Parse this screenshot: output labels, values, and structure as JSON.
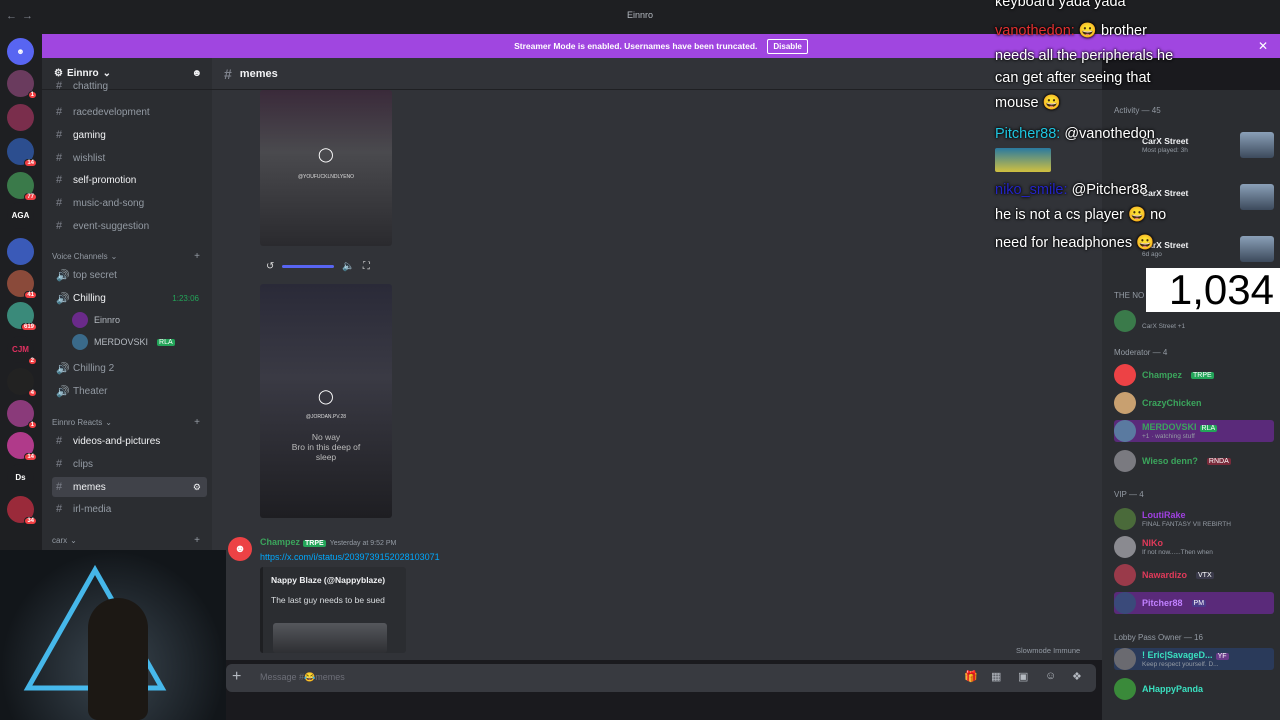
{
  "window": {
    "title": "Einnro"
  },
  "banner": {
    "text": "Streamer Mode is enabled. Usernames have been truncated.",
    "button": "Disable"
  },
  "guilds": [
    {
      "label": "",
      "badge": "1"
    },
    {
      "label": "",
      "badge": ""
    },
    {
      "label": "",
      "badge": "14"
    },
    {
      "label": "",
      "badge": "77"
    },
    {
      "label": "AGA",
      "badge": ""
    },
    {
      "label": "",
      "badge": ""
    },
    {
      "label": "",
      "badge": "41"
    },
    {
      "label": "",
      "badge": "619"
    },
    {
      "label": "CJM",
      "badge": "2"
    },
    {
      "label": "",
      "badge": "4"
    },
    {
      "label": "",
      "badge": "1"
    },
    {
      "label": "",
      "badge": "14"
    },
    {
      "label": "Ds",
      "badge": ""
    },
    {
      "label": "",
      "badge": "34"
    }
  ],
  "server": {
    "name": "Einnro"
  },
  "channels": {
    "text_top": [
      {
        "name": "chatting"
      },
      {
        "name": "racedevelopment"
      },
      {
        "name": "gaming"
      },
      {
        "name": "wishlist"
      },
      {
        "name": "self-promotion"
      },
      {
        "name": "music-and-song"
      },
      {
        "name": "event-suggestion"
      }
    ],
    "voice_category": "Voice Channels",
    "voice": [
      {
        "name": "top secret"
      },
      {
        "name": "Chilling",
        "timer": "1:23:06"
      },
      {
        "name": "Chilling 2"
      },
      {
        "name": "Theater"
      }
    ],
    "voice_users": [
      {
        "name": "Einnro"
      },
      {
        "name": "MERDOVSKI",
        "tag": "RLA"
      }
    ],
    "reacts_category": "Einnro Reacts",
    "reacts": [
      {
        "name": "videos-and-pictures"
      },
      {
        "name": "clips"
      },
      {
        "name": "memes"
      },
      {
        "name": "irl-media"
      }
    ],
    "carx_category": "carx"
  },
  "topbar": {
    "channel": "memes"
  },
  "media": {
    "ig1": "@YOUFUCKLNDLYENO",
    "ig2": "@JORDAN.PV.28",
    "caption": "No way\nBro in this deep of\nsleep"
  },
  "message": {
    "author": "Champez",
    "tag": "TRPE",
    "timestamp": "Yesterday at 9:52 PM",
    "link": "https://x.com/i/status/2039739152028103071",
    "embed_author": "Nappy Blaze (@Nappyblaze)",
    "embed_text": "The last guy needs to be sued"
  },
  "slowmode": "Slowmode Immune",
  "composer": {
    "placeholder": "Message #😂memes"
  },
  "members": {
    "activity_label": "Activity — 45",
    "activities": [
      {
        "name": "CarX Street",
        "status": "Most played: 3h"
      },
      {
        "name": "CarX Street",
        "status": ""
      },
      {
        "name": "CarX Street",
        "status": "6d ago"
      }
    ],
    "top_section": "THE NO",
    "top_member_status": "CarX Street +1",
    "moderator_label": "Moderator — 4",
    "moderators": [
      {
        "name": "Champez",
        "tag": "TRPE",
        "status": ""
      },
      {
        "name": "CrazyChicken",
        "tag": "",
        "status": ""
      },
      {
        "name": "MERDOVSKI",
        "tag": "RLA",
        "status": "+1 · watching stuff"
      },
      {
        "name": "Wieso denn?",
        "tag": "RNDA",
        "status": ""
      }
    ],
    "vip_label": "VIP — 4",
    "vips": [
      {
        "name": "LoutiRake",
        "tag": "",
        "status": "FINAL FANTASY VII REBIRTH"
      },
      {
        "name": "NIKo",
        "tag": "",
        "status": "If not now......Then when"
      },
      {
        "name": "Nawardizo",
        "tag": "VTX",
        "status": ""
      },
      {
        "name": "Pitcher88",
        "tag": "PM",
        "status": ""
      }
    ],
    "lobby_label": "Lobby Pass Owner — 16",
    "lobby": [
      {
        "name": "! Eric|SavageD...",
        "tag": "YF",
        "status": "Keep respect yourself. D..."
      },
      {
        "name": "AHappyPanda",
        "tag": "",
        "status": ""
      }
    ]
  },
  "overlay_chat": [
    {
      "user": "",
      "text": "keyboard yada yada"
    },
    {
      "user": "vanothedon:",
      "text": "brother"
    },
    {
      "user": "",
      "text": "needs all the peripherals he"
    },
    {
      "user": "",
      "text": "can get after seeing that"
    },
    {
      "user": "",
      "text": "mouse"
    },
    {
      "user": "Pitcher88:",
      "text": "@vanothedon"
    },
    {
      "user": "niko_smile:",
      "text": "@Pitcher88"
    },
    {
      "user": "",
      "text": "he is not a cs player"
    },
    {
      "user": "",
      "text": "no"
    },
    {
      "user": "",
      "text": "need for headphones"
    }
  ],
  "viewer_count": "1,034",
  "colors": {
    "banner": "#a046e0",
    "accent": "#5865f2",
    "link": "#00a8fc",
    "sidebar": "#2b2d31",
    "chat": "#313338"
  }
}
